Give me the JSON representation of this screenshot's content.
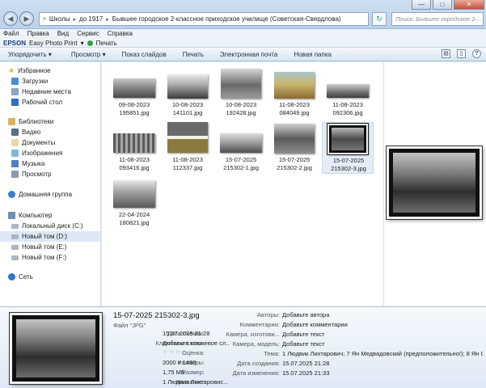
{
  "window": {
    "minimize": "—",
    "maximize": "□",
    "close": "✕"
  },
  "address": {
    "crumbs": [
      "Школы",
      "до 1917",
      "Бывшее городское 2-классное приходское училище (Советская-Свердлова)"
    ]
  },
  "search": {
    "placeholder": "Поиск: Бывшее городское 2-..."
  },
  "menu": [
    "Файл",
    "Правка",
    "Вид",
    "Сервис",
    "Справка"
  ],
  "epson": {
    "logo": "EPSON",
    "app": "Easy Photo Print",
    "print": "Печать"
  },
  "toolbar": [
    "Упорядочить ▾",
    "Просмотр ▾",
    "Показ слайдов",
    "Печать",
    "Электронная почта",
    "Новая папка"
  ],
  "nav": {
    "favorites": {
      "title": "Избранное",
      "items": [
        "Загрузки",
        "Недавние места",
        "Рабочий стол"
      ]
    },
    "libraries": {
      "title": "Библиотеки",
      "items": [
        "Видео",
        "Документы",
        "Изображения",
        "Музыка",
        "Просмотр"
      ]
    },
    "homegroup": "Домашняя группа",
    "computer": {
      "title": "Компьютер",
      "items": [
        "Локальный диск (C:)",
        "Новый том (D:)",
        "Новый том (E:)",
        "Новый том (F:)"
      ]
    },
    "network": "Сеть"
  },
  "files": [
    {
      "line1": "09-08-2023",
      "line2": "195851.jpg"
    },
    {
      "line1": "10-08-2023",
      "line2": "141101.jpg"
    },
    {
      "line1": "10-08-2023",
      "line2": "192428.jpg"
    },
    {
      "line1": "11-08-2023",
      "line2": "084049.jpg"
    },
    {
      "line1": "11-08-2023",
      "line2": "092306.jpg"
    },
    {
      "line1": "11-08-2023",
      "line2": "093416.jpg"
    },
    {
      "line1": "11-08-2023",
      "line2": "112337.jpg"
    },
    {
      "line1": "15-07-2025",
      "line2": "215302-1.jpg"
    },
    {
      "line1": "15-07-2025",
      "line2": "215302-2.jpg"
    },
    {
      "line1": "15-07-2025",
      "line2": "215302-3.jpg"
    },
    {
      "line1": "22-04-2024",
      "line2": "180821.jpg"
    }
  ],
  "details": {
    "name": "15-07-2025 215302-3.jpg",
    "type": "Файл \"JPG\"",
    "left": [
      {
        "label": "Дата съемки:",
        "value": "15.07.2025 21:28"
      },
      {
        "label": "Ключевые слова:",
        "value": "Добавьте ключевое сл..."
      },
      {
        "label": "Оценка:",
        "value": "☆☆☆☆☆"
      },
      {
        "label": "Размеры:",
        "value": "2000 x 1493"
      },
      {
        "label": "Размер:",
        "value": "1,75 МБ"
      },
      {
        "label": "Название:",
        "value": "1 Людвик Лихтаровиc..."
      }
    ],
    "right": [
      {
        "label": "Авторы:",
        "value": "Добавьте автора"
      },
      {
        "label": "Комментарии:",
        "value": "Добавьте комментарии"
      },
      {
        "label": "Камера, изготови...",
        "value": "Добавьте текст"
      },
      {
        "label": "Камера, модель:",
        "value": "Добавьте текст"
      },
      {
        "label": "Тема:",
        "value": "1 Людвик Лихтарович; 7 Ян Медвадовский (предположительно!); 8 Ян Ск..."
      },
      {
        "label": "Дата создания:",
        "value": "15.07.2025 21:28"
      },
      {
        "label": "Дата изменения:",
        "value": "15.07.2025 21:33"
      }
    ]
  }
}
